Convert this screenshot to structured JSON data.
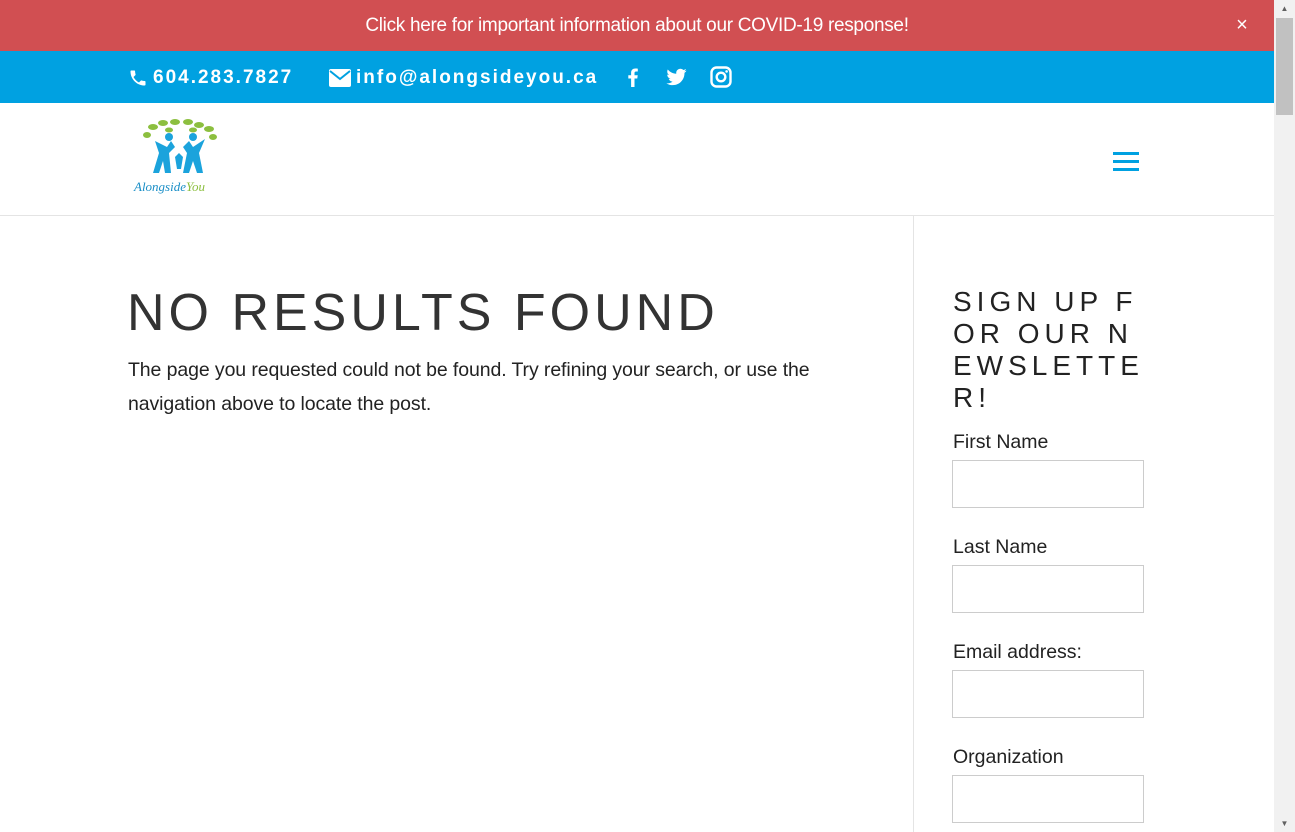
{
  "notice": {
    "text": "Click here for important information about our COVID-19 response!",
    "close": "×"
  },
  "topbar": {
    "phone": "604.283.7827",
    "email": "info@alongsideyou.ca",
    "social": [
      "facebook-icon",
      "twitter-icon",
      "instagram-icon"
    ]
  },
  "header": {
    "logo_text_main": "Alongside",
    "logo_text_accent": "You",
    "menu_icon": "hamburger-menu-icon"
  },
  "main": {
    "title": "NO RESULTS FOUND",
    "message": "The page you requested could not be found. Try refining your search, or use the navigation above to locate the post."
  },
  "sidebar": {
    "title": "SIGN UP FOR OUR NEWSLETTER!",
    "fields": [
      {
        "label": "First Name",
        "value": ""
      },
      {
        "label": "Last Name",
        "value": ""
      },
      {
        "label": "Email address:",
        "value": ""
      },
      {
        "label": "Organization",
        "value": ""
      }
    ]
  },
  "colors": {
    "notice_bg": "#d14f52",
    "brand_blue": "#00a1e1",
    "logo_green": "#8cbf3f"
  }
}
